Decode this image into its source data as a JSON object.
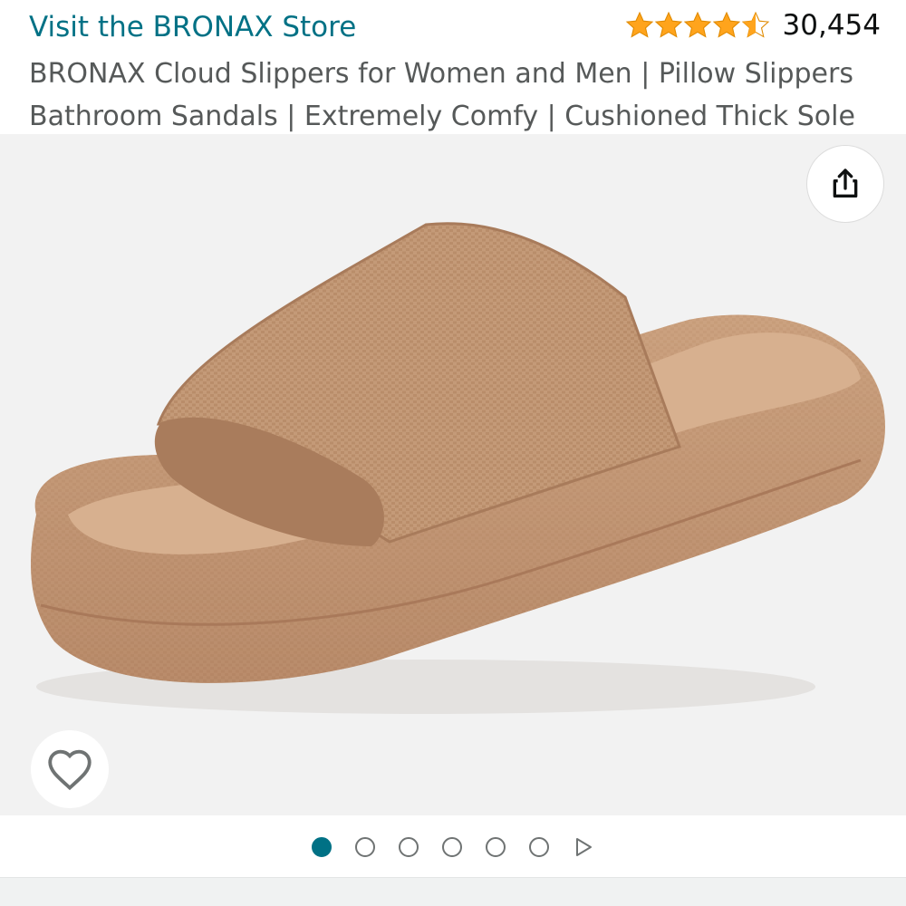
{
  "header": {
    "store_link": "Visit the BRONAX Store",
    "rating_value": 4.5,
    "rating_count": "30,454",
    "title": "BRONAX Cloud Slippers for Women and Men | Pillow Slippers Bathroom Sandals | Extremely Comfy | Cushioned Thick Sole"
  },
  "gallery": {
    "image_subject": "slide-sandal-product-photo",
    "share_icon": "share-icon",
    "wishlist_icon": "heart-icon",
    "total_images": 6,
    "active_index": 0,
    "next_icon": "play-triangle-icon"
  },
  "colors": {
    "link": "#007185",
    "star": "#FFA41C",
    "sandal": "#c49a78",
    "background": "#f2f2f2"
  }
}
